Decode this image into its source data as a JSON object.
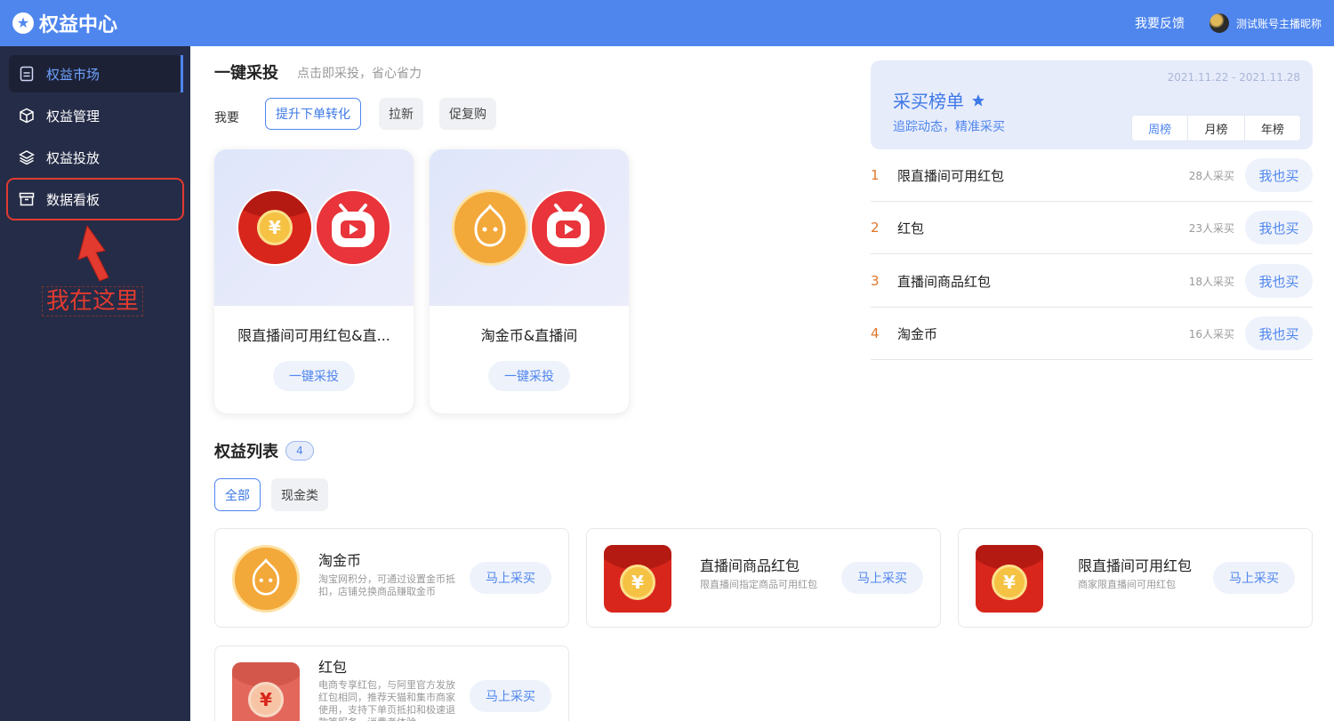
{
  "header": {
    "title": "权益中心",
    "feedback": "我要反馈",
    "username": "测试账号主播昵称"
  },
  "sidebar": {
    "items": [
      {
        "label": "权益市场",
        "icon": "document-icon"
      },
      {
        "label": "权益管理",
        "icon": "box-icon"
      },
      {
        "label": "权益投放",
        "icon": "layers-icon"
      },
      {
        "label": "数据看板",
        "icon": "archive-icon"
      }
    ],
    "annotation": "我在这里"
  },
  "quick": {
    "title": "一键采投",
    "subtitle": "点击即采投，省心省力",
    "want_label": "我要",
    "chips": [
      "提升下单转化",
      "拉新",
      "促复购"
    ],
    "cards": [
      {
        "name": "限直播间可用红包&直...",
        "button": "一键采投"
      },
      {
        "name": "淘金币&直播间",
        "button": "一键采投"
      }
    ]
  },
  "ranking": {
    "date_range": "2021.11.22 - 2021.11.28",
    "title": "采买榜单",
    "subtitle": "追踪动态，精准采买",
    "tabs": [
      "周榜",
      "月榜",
      "年榜"
    ],
    "rows": [
      {
        "no": "1",
        "name": "限直播间可用红包",
        "count": "28人采买",
        "button": "我也买"
      },
      {
        "no": "2",
        "name": "红包",
        "count": "23人采买",
        "button": "我也买"
      },
      {
        "no": "3",
        "name": "直播间商品红包",
        "count": "18人采买",
        "button": "我也买"
      },
      {
        "no": "4",
        "name": "淘金币",
        "count": "16人采买",
        "button": "我也买"
      }
    ]
  },
  "list": {
    "title": "权益列表",
    "count": "4",
    "filters": [
      "全部",
      "现金类"
    ],
    "items": [
      {
        "name": "淘金币",
        "desc": "淘宝网积分，可通过设置金币抵扣，店铺兑换商品赚取金币",
        "button": "马上采买"
      },
      {
        "name": "直播间商品红包",
        "desc": "限直播间指定商品可用红包",
        "button": "马上采买"
      },
      {
        "name": "限直播间可用红包",
        "desc": "商家限直播间可用红包",
        "button": "马上采买"
      },
      {
        "name": "红包",
        "desc": "电商专享红包，与阿里官方发放红包相同，推荐天猫和集市商家使用，支持下单页抵扣和极速退款等服务，消费者体验",
        "button": "马上采买"
      }
    ]
  },
  "colors": {
    "accent": "#4f86ee",
    "sidebar_bg": "#252c47",
    "annotation_red": "#e23a2f",
    "rank_number": "#e0772b"
  }
}
